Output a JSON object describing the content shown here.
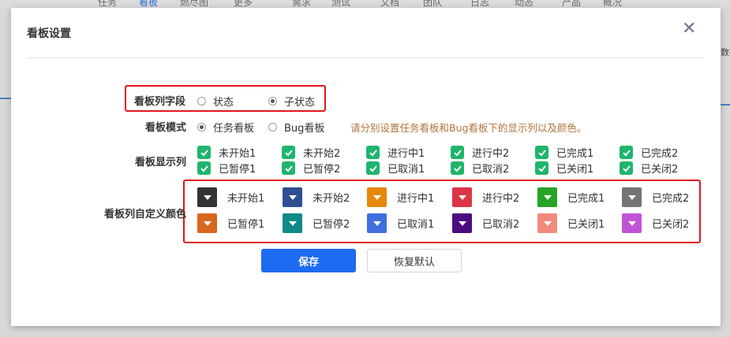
{
  "background": {
    "nav_items": [
      "任务",
      "看板",
      "燃尽图",
      "更多",
      "需求",
      "测试",
      "文档",
      "团队",
      "日志",
      "动态",
      "产品",
      "概况"
    ],
    "right_fragment": "数据"
  },
  "modal": {
    "title": "看板设置"
  },
  "form": {
    "column_field": {
      "label": "看板列字段",
      "options": [
        {
          "label": "状态",
          "selected": false
        },
        {
          "label": "子状态",
          "selected": true
        }
      ]
    },
    "mode": {
      "label": "看板模式",
      "options": [
        {
          "label": "任务看板",
          "selected": true
        },
        {
          "label": "Bug看板",
          "selected": false
        }
      ],
      "hint": "请分别设置任务看板和Bug看板下的显示列以及颜色。"
    },
    "display_columns": {
      "label": "看板显示列",
      "items": [
        "未开始1",
        "未开始2",
        "进行中1",
        "进行中2",
        "已完成1",
        "已完成2",
        "已暂停1",
        "已暂停2",
        "已取消1",
        "已取消2",
        "已关闭1",
        "已关闭2"
      ]
    },
    "custom_colors": {
      "label": "看板列自定义颜色",
      "items": [
        {
          "label": "未开始1",
          "color": "#333333"
        },
        {
          "label": "未开始2",
          "color": "#2f4f94"
        },
        {
          "label": "进行中1",
          "color": "#e6880c"
        },
        {
          "label": "进行中2",
          "color": "#dc3545"
        },
        {
          "label": "已完成1",
          "color": "#27a327"
        },
        {
          "label": "已完成2",
          "color": "#747474"
        },
        {
          "label": "已暂停1",
          "color": "#d8661f"
        },
        {
          "label": "已暂停2",
          "color": "#0e8a87"
        },
        {
          "label": "已取消1",
          "color": "#3f6fe0"
        },
        {
          "label": "已取消2",
          "color": "#4b0c80"
        },
        {
          "label": "已关闭1",
          "color": "#f28a7b"
        },
        {
          "label": "已关闭2",
          "color": "#c054d6"
        }
      ]
    }
  },
  "buttons": {
    "save": "保存",
    "reset": "恢复默认"
  },
  "colors": {
    "checkbox": "#1fb56c",
    "primary": "#1c6bf1",
    "highlight": "#e0181e",
    "hint": "#b3743c"
  }
}
